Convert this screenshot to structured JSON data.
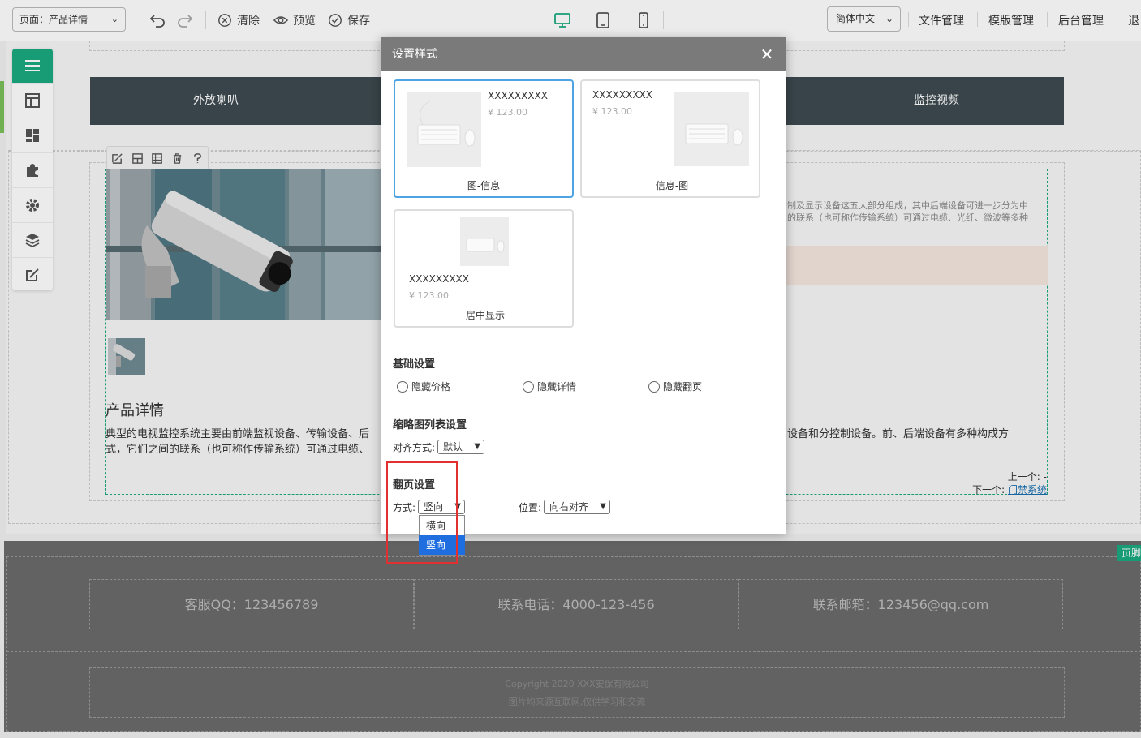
{
  "toolbar": {
    "page_select": "页面：产品详情",
    "clear_label": "清除",
    "preview_label": "预览",
    "save_label": "保存",
    "lang_select": "简体中文",
    "nav_links": [
      "文件管理",
      "模版管理",
      "后台管理",
      "退"
    ]
  },
  "site": {
    "nav_items": [
      "外放喇叭",
      "监控视频"
    ],
    "product_title": "产品详情",
    "product_desc_left": "典型的电视监控系统主要由前端监视设备、传输设备、后",
    "product_desc_left2": "式，它们之间的联系（也可称作传输系统）可通过电缆、",
    "product_desc_right": "设备和分控制设备。前、后端设备有多种构成方",
    "side_text_1": "制及显示设备这五大部分组成，其中后端设备可进一步分为中",
    "side_text_2": "的联系（也可称作传输系统）可通过电缆、光纤、微波等多种",
    "prev_label": "上一个: -",
    "next_label": "下一个:",
    "next_link": "门禁系统",
    "footer_qq": "客服QQ：123456789",
    "footer_phone": "联系电话：4000-123-456",
    "footer_email": "联系邮箱：123456@qq.com",
    "copyright": "Copyright 2020 XXX安保有限公司",
    "copyright_note": "图片均来源互联网,仅供学习和交流",
    "footer_tag": "页脚"
  },
  "modal": {
    "title": "设置样式",
    "cards": [
      {
        "name": "XXXXXXXXX",
        "price": "¥ 123.00",
        "label": "图-信息",
        "selected": true
      },
      {
        "name": "XXXXXXXXX",
        "price": "¥ 123.00",
        "label": "信息-图",
        "selected": false
      },
      {
        "name": "XXXXXXXXX",
        "price": "¥ 123.00",
        "label": "居中显示",
        "selected": false
      }
    ],
    "basic_title": "基础设置",
    "radios": [
      "隐藏价格",
      "隐藏详情",
      "隐藏翻页"
    ],
    "thumb_title": "缩略图列表设置",
    "align_label": "对齐方式:",
    "align_value": "默认",
    "page_title": "翻页设置",
    "mode_label": "方式:",
    "mode_value": "竖向",
    "position_label": "位置:",
    "position_value": "向右对齐",
    "dropdown_options": [
      "横向",
      "竖向"
    ],
    "dropdown_active": "竖向"
  },
  "colors": {
    "accent": "#1aaa7f",
    "navbar": "#3d4a50",
    "selected_border": "#4ea4e2",
    "highlight": "#e03030",
    "option_active": "#1e6ee0"
  }
}
